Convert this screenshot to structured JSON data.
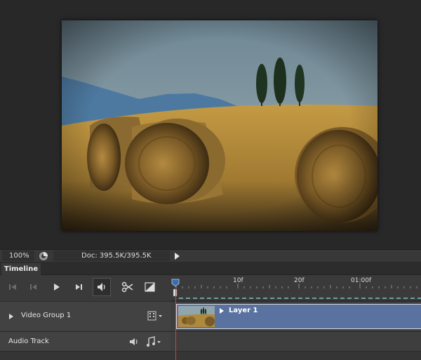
{
  "status_bar": {
    "zoom": "100%",
    "doc_info": "Doc: 395.5K/395.5K"
  },
  "timeline": {
    "tab_label": "Timeline",
    "ruler_labels": [
      "10f",
      "20f",
      "01:00f"
    ],
    "tracks": {
      "video_group": "Video Group 1",
      "audio_track": "Audio Track"
    },
    "clip_label": "Layer 1"
  },
  "icons": {
    "controls": [
      "go-to-first-frame-icon",
      "previous-frame-icon",
      "play-icon",
      "next-frame-icon",
      "audio-mute-icon",
      "split-icon",
      "transition-icon"
    ],
    "colors": {
      "clip": "#5a72a0",
      "playhead": "#d04040",
      "panel": "#3a3a3a"
    }
  }
}
